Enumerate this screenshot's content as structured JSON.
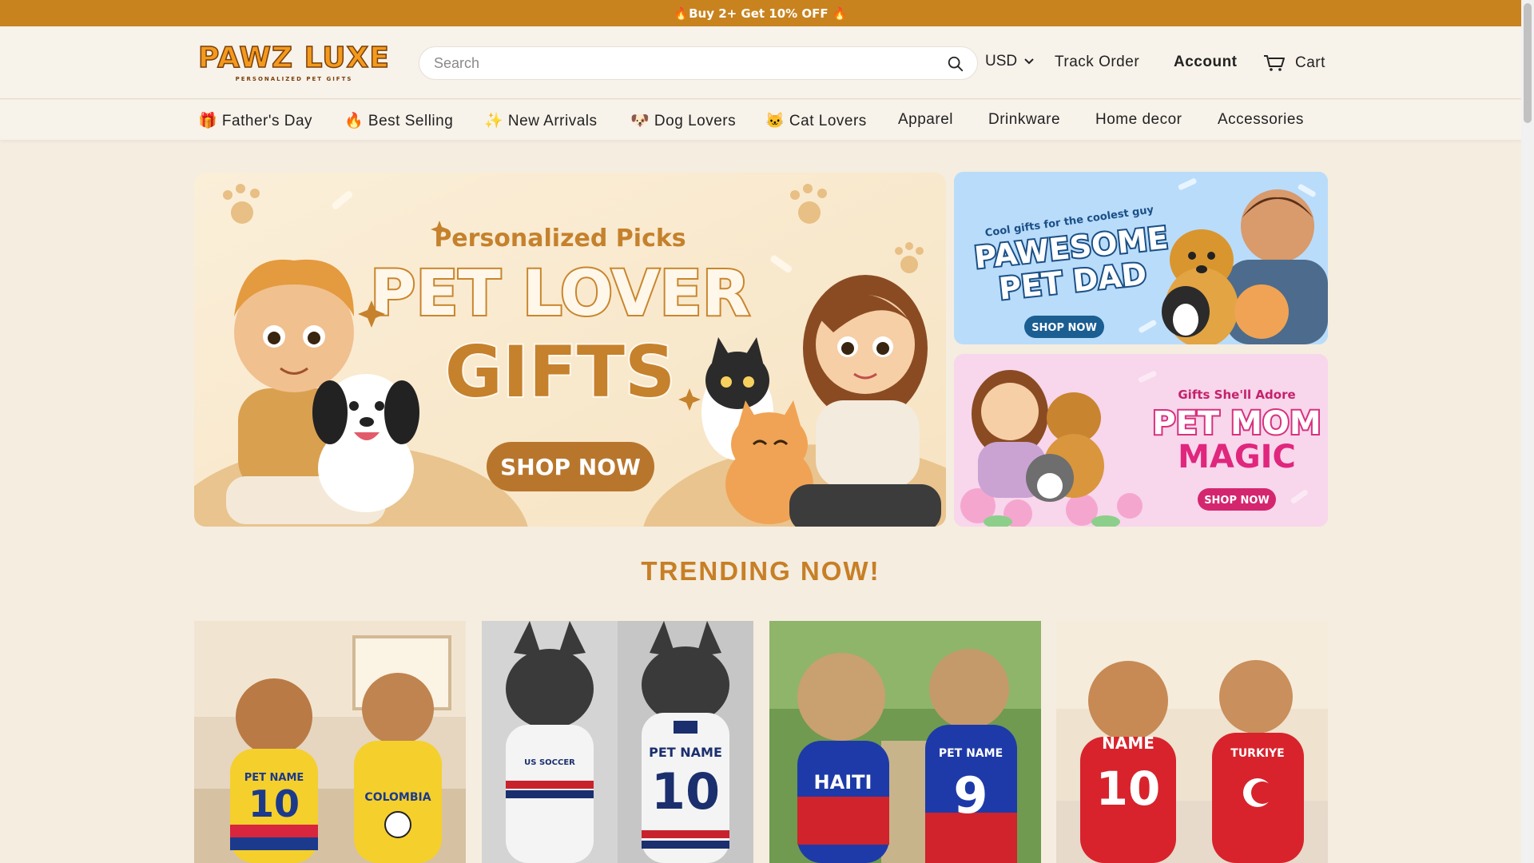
{
  "announcement": {
    "text": "🔥Buy 2+ Get 10% OFF 🔥"
  },
  "header": {
    "logo_text": "PAWZ LUXE",
    "logo_subtext": "PERSONALIZED PET GIFTS",
    "search_placeholder": "Search",
    "currency": "USD",
    "track_order": "Track Order",
    "account": "Account",
    "cart": "Cart"
  },
  "nav": {
    "items": [
      {
        "label": "🎁 Father's Day"
      },
      {
        "label": "🔥 Best Selling"
      },
      {
        "label": "✨ New Arrivals"
      },
      {
        "label": "🐶 Dog Lovers"
      },
      {
        "label": "🐱 Cat Lovers"
      },
      {
        "label": "Apparel"
      },
      {
        "label": "Drinkware"
      },
      {
        "label": "Home decor"
      },
      {
        "label": "Accessories"
      }
    ]
  },
  "hero": {
    "main": {
      "kicker": "Personalized Picks",
      "title_line1": "PET LOVER",
      "title_line2": "GIFTS",
      "cta": "SHOP NOW"
    },
    "side1": {
      "kicker": "Cool gifts for the coolest guy",
      "title_line1": "PAWESOME",
      "title_line2": "PET DAD",
      "cta": "SHOP NOW"
    },
    "side2": {
      "kicker": "Gifts She'll Adore",
      "title_line1": "PET MOM",
      "title_line2": "MAGIC",
      "cta": "SHOP NOW"
    }
  },
  "trending": {
    "heading": "TRENDING NOW!"
  },
  "products": [
    {
      "jersey1_text": "PET NAME",
      "jersey1_number": "10",
      "jersey2_text": "COLOMBIA"
    },
    {
      "jersey1_text": "US SOCCER",
      "jersey2_text": "PET NAME",
      "jersey2_number": "10"
    },
    {
      "jersey1_text": "HAITI",
      "jersey2_text": "PET NAME",
      "jersey2_number": "9"
    },
    {
      "jersey1_text": "NAME",
      "jersey1_number": "10",
      "jersey2_text": "TURKIYE"
    }
  ],
  "colors": {
    "announcement_bg": "#c8831f",
    "page_bg": "#f5ede0",
    "accent": "#c77f26",
    "cta_brown": "#b8762d"
  }
}
